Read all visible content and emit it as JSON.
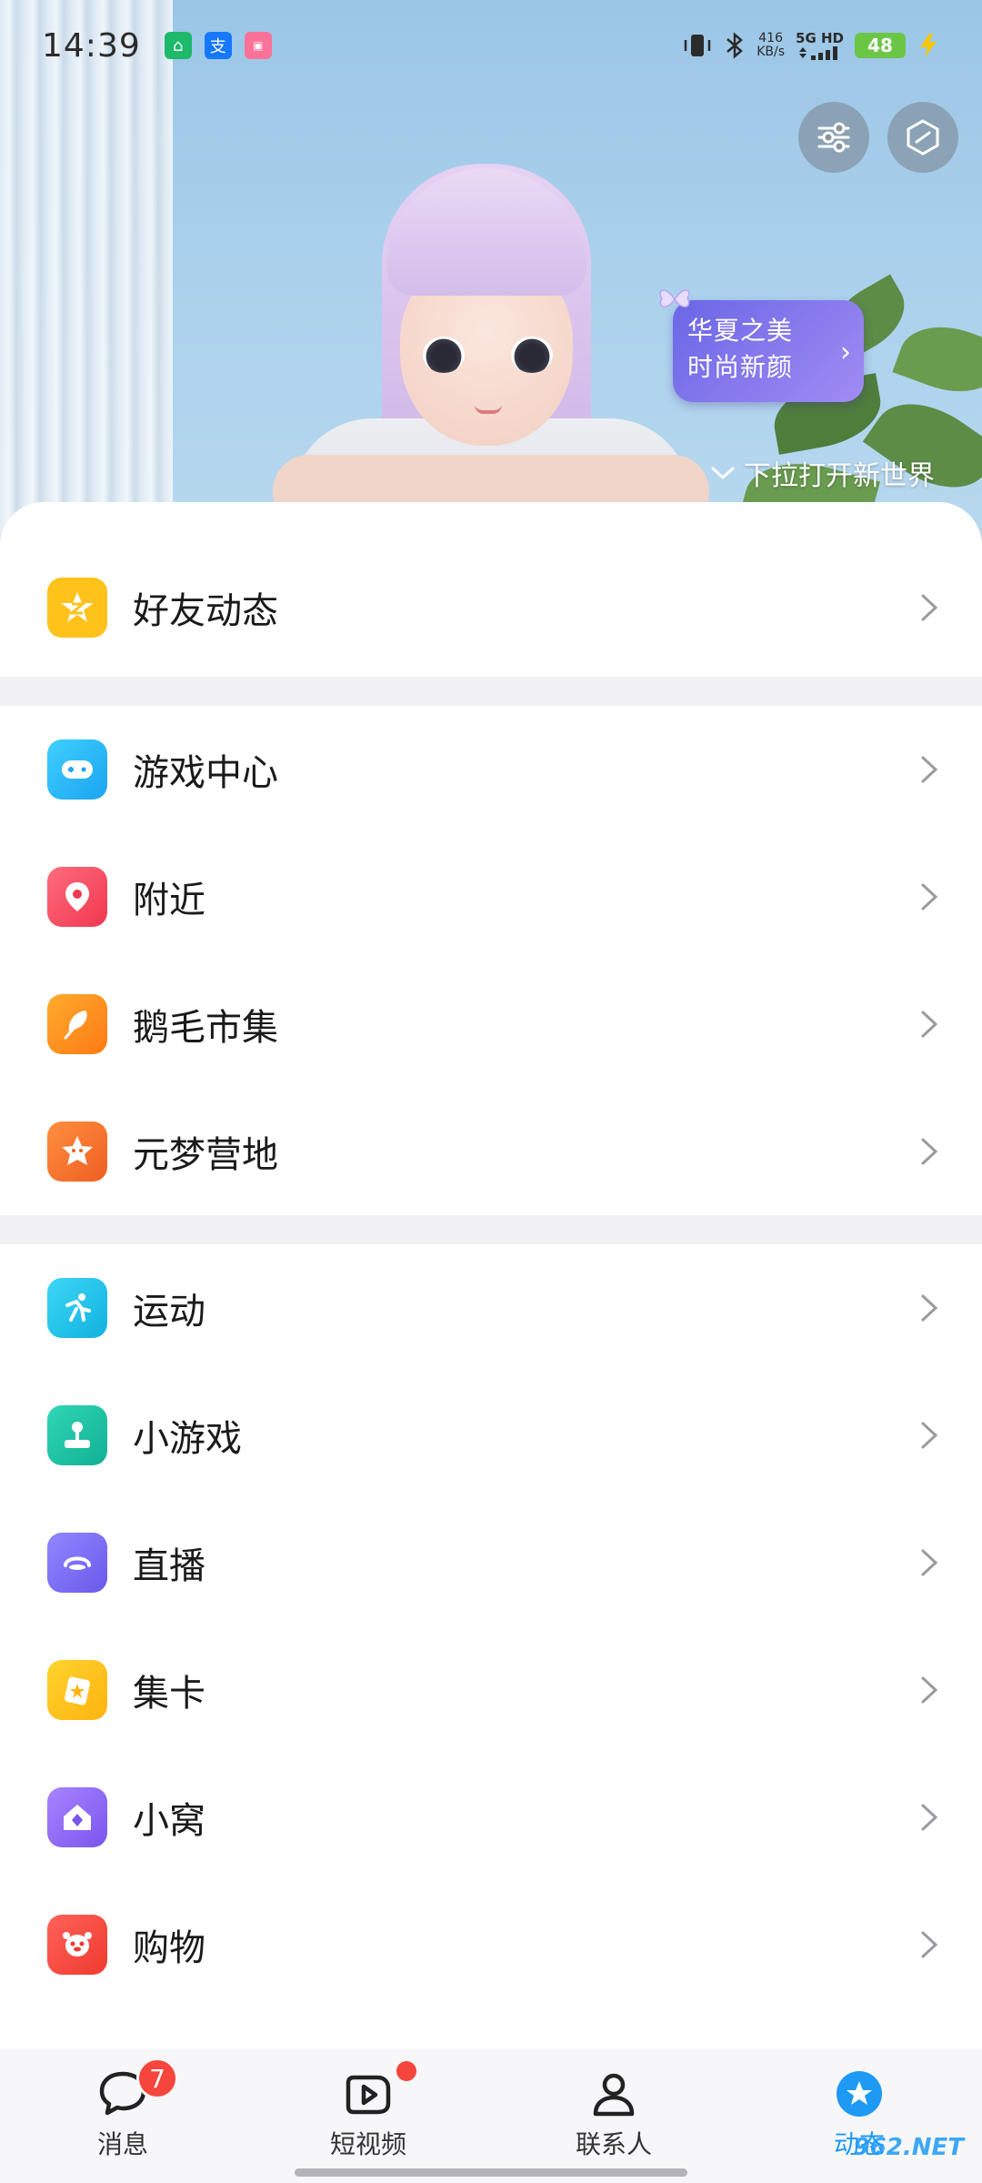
{
  "status_bar": {
    "time": "14:39",
    "net_speed_value": "416",
    "net_speed_unit": "KB/s",
    "net_type": "5G HD",
    "battery": "48",
    "notification_icons": [
      "mi-home-icon",
      "alipay-icon",
      "bilibili-icon"
    ]
  },
  "hero": {
    "bubble_line1": "华夏之美",
    "bubble_line2": "时尚新颜",
    "pull_hint": "下拉打开新世界",
    "top_buttons": [
      "settings-sliders-icon",
      "hexagon-icon"
    ]
  },
  "menu": {
    "group1": [
      {
        "label": "好友动态",
        "icon": "friends-feed-icon",
        "color": "#ffc21a"
      }
    ],
    "group2": [
      {
        "label": "游戏中心",
        "icon": "gamepad-icon",
        "color": "#29b6f6"
      },
      {
        "label": "附近",
        "icon": "location-pin-icon",
        "color": "#f5475d"
      },
      {
        "label": "鹅毛市集",
        "icon": "feather-icon",
        "color": "#ff8f1f"
      },
      {
        "label": "元梦营地",
        "icon": "star-character-icon",
        "color": "#f2752b"
      }
    ],
    "group3": [
      {
        "label": "运动",
        "icon": "running-icon",
        "color": "#16c0e8"
      },
      {
        "label": "小游戏",
        "icon": "joystick-icon",
        "color": "#19c2a4"
      },
      {
        "label": "直播",
        "icon": "live-icon",
        "color": "#7b6cf2"
      },
      {
        "label": "集卡",
        "icon": "card-icon",
        "color": "#ffc21a"
      },
      {
        "label": "小窝",
        "icon": "home-diamond-icon",
        "color": "#8a62f0"
      },
      {
        "label": "购物",
        "icon": "shopping-penguin-icon",
        "color": "#f5453c"
      }
    ]
  },
  "tabbar": {
    "messages": "消息",
    "messages_badge": "7",
    "short_video": "短视频",
    "contacts": "联系人",
    "dynamic": "动态"
  },
  "watermark": "962.NET"
}
